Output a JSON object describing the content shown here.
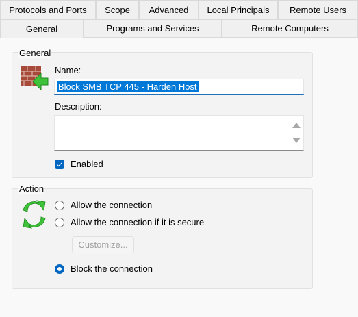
{
  "tabs_back": [
    {
      "label": "Protocols and Ports"
    },
    {
      "label": "Scope"
    },
    {
      "label": "Advanced"
    },
    {
      "label": "Local Principals"
    },
    {
      "label": "Remote Users"
    }
  ],
  "tabs_front": [
    {
      "label": "General"
    },
    {
      "label": "Programs and Services"
    },
    {
      "label": "Remote Computers"
    }
  ],
  "active_tab": "General",
  "general": {
    "group_title": "General",
    "name_label": "Name:",
    "name_value": "Block SMB TCP 445 - Harden Host",
    "description_label": "Description:",
    "description_value": "",
    "enabled_label": "Enabled",
    "enabled": true,
    "icon": "firewall-rule-icon"
  },
  "action": {
    "group_title": "Action",
    "icon": "refresh-arrows-icon",
    "options": [
      {
        "label": "Allow the connection",
        "checked": false
      },
      {
        "label": "Allow the connection if it is secure",
        "checked": false
      },
      {
        "label": "Block the connection",
        "checked": true
      }
    ],
    "customize_label": "Customize...",
    "customize_enabled": false
  },
  "colors": {
    "accent": "#0067c0",
    "selection": "#0078d7"
  }
}
